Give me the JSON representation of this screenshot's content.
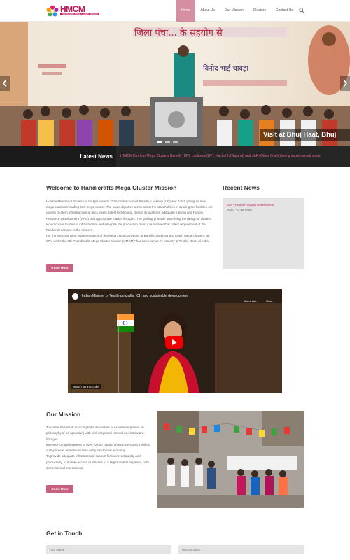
{
  "header": {
    "logo_text": "HMCM",
    "logo_subtext": "Handicrafts Mega Cluster Mission",
    "nav": [
      {
        "label": "Home",
        "active": true
      },
      {
        "label": "About Us",
        "active": false
      },
      {
        "label": "Our Mission",
        "active": false
      },
      {
        "label": "Clusters",
        "active": false
      },
      {
        "label": "Contact Us",
        "active": false
      }
    ]
  },
  "slider": {
    "banner_text_top": "जिला पंचा... के सहयोग से",
    "banner_text_mid": "विनोद भाई चावड़ा",
    "caption": "Visit at Bhuj Haat, Bhuj",
    "slide_count": 3,
    "active_slide": 1
  },
  "news_bar": {
    "label": "Latest News",
    "ticker": "(HMCM) for four Mega Clusters Bareilly (UP), Lucknow (UP), Kachchh (Gujarat) and J&K (Other Crafts) being implemented since"
  },
  "welcome": {
    "title": "Welcome to Handicrafts Mega Cluster Mission",
    "paragraphs": [
      "Hon'ble Minister of Finance in budget speech 2014-15 announced Bareilly, Lucknow (UP) and Kutch (Bhuj) as new mega clusters including J&K mega cluster. The basic objective are to assist the stakeholders in availing the facilities set up with modern infrastructure at brick levels, latest technology, design innovations, adequate training and Human Resource Development (HRD) and appropriate market linkages. The guiding principle underlying the design of clusters would create models in infrastructure and integrate the production chain in a manner that caters requirement of the handicraft artisans in the clusters.",
      "For the execution and implementation of the Mega cluster activities at Bareilly, Lucknow and Kutch Mega Clusters, an SPV under the title \"Handicrafts Mega Cluster Mission (HMCM)\" has been set up by Ministry of Textile, Govt. of India."
    ],
    "button": "Know More"
  },
  "recent_news": {
    "title": "Recent News",
    "items": [
      {
        "link": "EOI - HMCM- Impact Assessment",
        "date": "Date : 24.06.2020"
      }
    ]
  },
  "video": {
    "title": "Indian Minister of Textile on crafts, ICH and sustainable development",
    "watch_later": "Watch later",
    "share": "Share",
    "watch_on": "Watch on YouTube"
  },
  "mission": {
    "title": "Our Mission",
    "paragraphs": [
      "To create handicraft sourcing hubs as centres of excellence (based on philosophy of co-operation) with well integrated forward and backward linkages.",
      "Increase competitiveness of over 10,000 handicraft exporters and a million craft-persons and ensure their entry into formal economy.",
      "To provide adequate infrastructural support for improved quality and productivity, to enable access of artisans to a larger market segment, both domestic and international."
    ],
    "button": "Know More"
  },
  "contact": {
    "title": "Get in Touch",
    "name_placeholder": "Your Name",
    "location_placeholder": "Your Location"
  },
  "colors": {
    "accent": "#c8617f",
    "nav_active": "#d48fa1",
    "news_bar": "#262626",
    "ticker_text": "#e26a94",
    "link": "#c2185b"
  }
}
